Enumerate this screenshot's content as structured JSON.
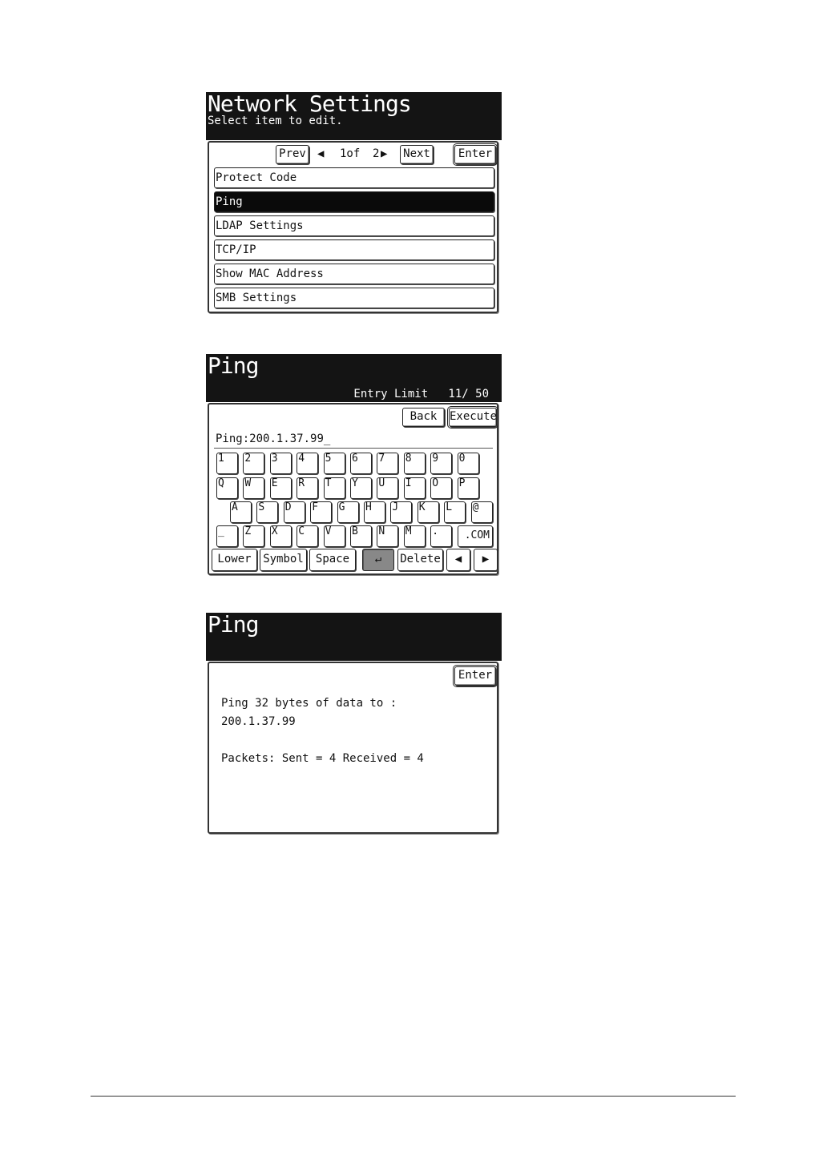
{
  "screen1": {
    "title": "Network Settings",
    "subtitle": "Select item to edit.",
    "nav": {
      "prev": "Prev",
      "page_left": "◀",
      "page_current": "1of",
      "page_total": "2",
      "page_right": "▶",
      "next": "Next",
      "enter": "Enter"
    },
    "items": [
      "Protect Code",
      "Ping",
      "LDAP Settings",
      "TCP/IP",
      "Show MAC Address",
      "SMB Settings"
    ],
    "selected_index": 1
  },
  "screen2": {
    "title": "Ping",
    "entry_limit_label": "Entry Limit",
    "entry_limit_value": "11/ 50",
    "back": "Back",
    "execute": "Execute",
    "input_label": "Ping:",
    "input_value": "200.1.37.99",
    "keys_row1": [
      "1",
      "2",
      "3",
      "4",
      "5",
      "6",
      "7",
      "8",
      "9",
      "0"
    ],
    "keys_row2": [
      "Q",
      "W",
      "E",
      "R",
      "T",
      "Y",
      "U",
      "I",
      "O",
      "P"
    ],
    "keys_row3": [
      "A",
      "S",
      "D",
      "F",
      "G",
      "H",
      "J",
      "K",
      "L",
      "@"
    ],
    "keys_row4": [
      "_",
      "Z",
      "X",
      "C",
      "V",
      "B",
      "N",
      "M",
      "."
    ],
    "key_dotcom": ".COM",
    "lower": "Lower",
    "symbol": "Symbol",
    "space": "Space",
    "enter_glyph": "↵",
    "delete": "Delete",
    "left_arrow": "◀",
    "right_arrow": "▶"
  },
  "screen3": {
    "title": "Ping",
    "enter": "Enter",
    "line1": "Ping 32 bytes of data to :",
    "line2": "200.1.37.99",
    "line3": "Packets: Sent = 4 Received = 4"
  }
}
